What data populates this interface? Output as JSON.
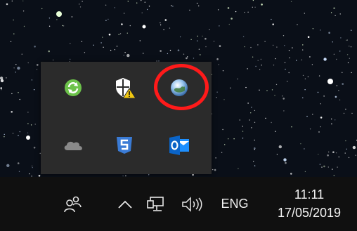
{
  "tray_flyout": {
    "icons": [
      {
        "name": "sync-icon",
        "color": "#6cc24a"
      },
      {
        "name": "security-shield-warning-icon",
        "color": "#f2c811"
      },
      {
        "name": "globe-app-icon",
        "color": "#4a90d9"
      },
      {
        "name": "onedrive-cloud-icon",
        "color": "#8a8a8a"
      },
      {
        "name": "html5-s-icon",
        "color": "#3a7bd5"
      },
      {
        "name": "outlook-icon",
        "color": "#0a64c8"
      }
    ],
    "highlight_color": "#ff1a1a"
  },
  "taskbar": {
    "people_icon": "people-icon",
    "show_hidden_icon": "chevron-up-icon",
    "network_icon": "network-icon",
    "volume_icon": "volume-icon",
    "language": "ENG",
    "time": "11:11",
    "date": "17/05/2019"
  }
}
